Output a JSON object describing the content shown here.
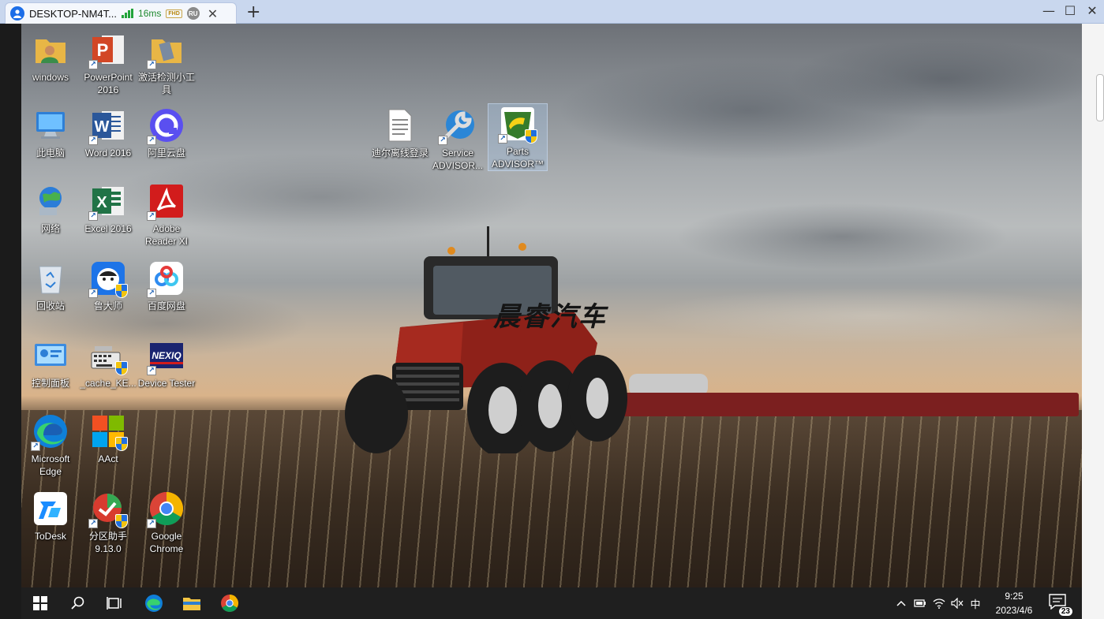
{
  "tab": {
    "title": "DESKTOP-NM4T...",
    "ping": "16ms",
    "quality": "FHD",
    "user_badge": "RU"
  },
  "window_controls": {
    "minimize": "—",
    "maximize": "☐",
    "close": "✕"
  },
  "new_tab": "+",
  "desktop": {
    "watermark": "晨睿汽车",
    "icons": [
      {
        "label": "windows"
      },
      {
        "label": "PowerPoint 2016"
      },
      {
        "label": "激活检测小工具"
      },
      {
        "label": "此电脑"
      },
      {
        "label": "Word 2016"
      },
      {
        "label": "阿里云盘"
      },
      {
        "label": "网络"
      },
      {
        "label": "Excel 2016"
      },
      {
        "label": "Adobe Reader XI"
      },
      {
        "label": "回收站"
      },
      {
        "label": "鲁大师"
      },
      {
        "label": "百度网盘"
      },
      {
        "label": "控制面板"
      },
      {
        "label": "_cache_KE..."
      },
      {
        "label": "Device Tester"
      },
      {
        "label": "Microsoft Edge"
      },
      {
        "label": "AAct"
      },
      {
        "label": "ToDesk"
      },
      {
        "label": "分区助手 9.13.0"
      },
      {
        "label": "Google Chrome"
      },
      {
        "label": "迪尔离线登录"
      },
      {
        "label": "Service ADVISOR..."
      },
      {
        "label": "Parts ADVISOR™"
      }
    ],
    "edge_handle": "‹"
  },
  "taskbar": {
    "ime": "中",
    "time": "9:25",
    "date": "2023/4/6",
    "notifications": "23"
  },
  "colors": {
    "accent": "#2a86ff",
    "taskbar": "#1f1f1f",
    "tab_bar": "#c9d7ee"
  }
}
